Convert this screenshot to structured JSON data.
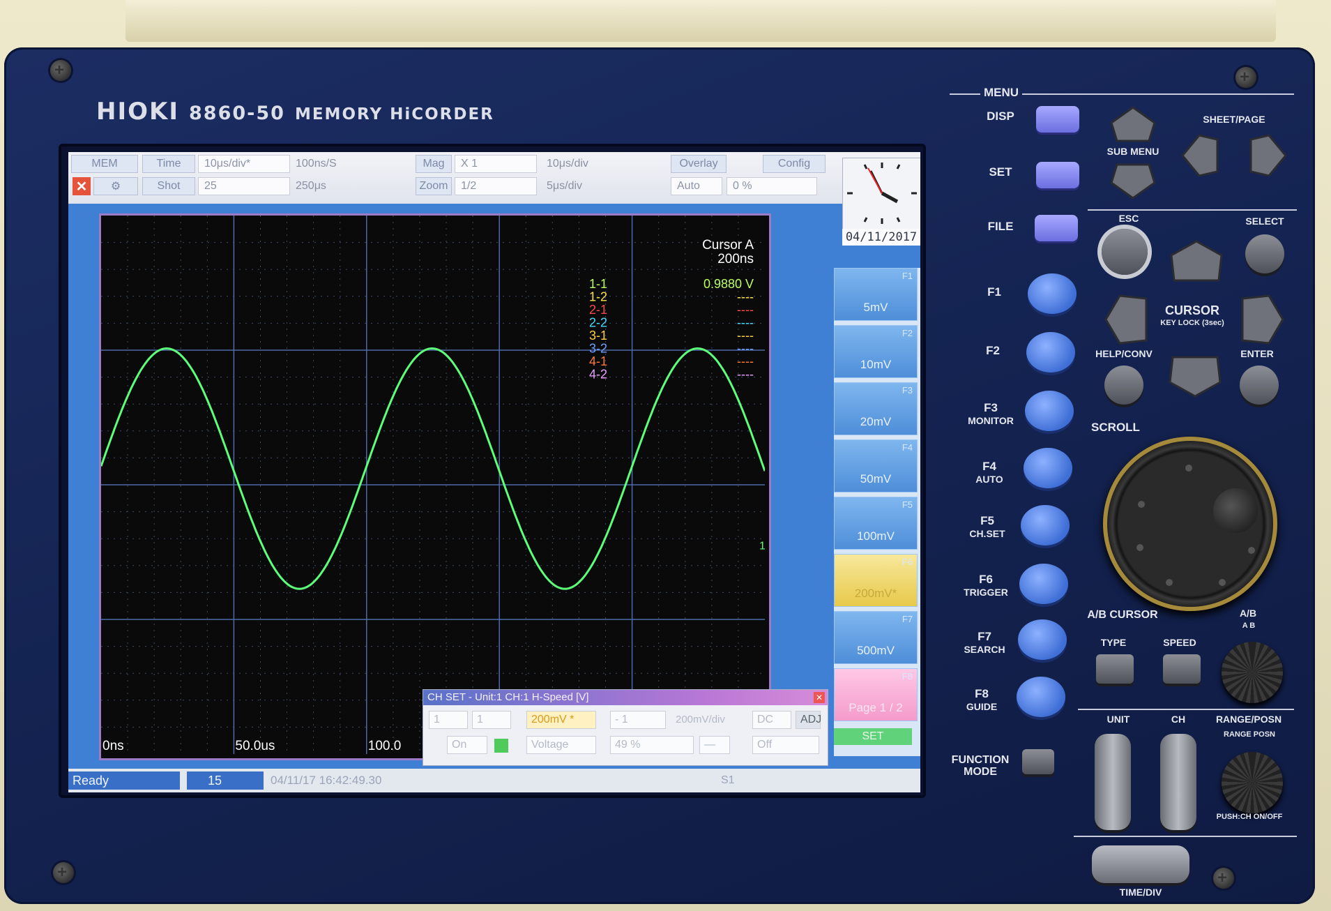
{
  "brand": {
    "logo": "HIOKI",
    "model": "8860-50",
    "name": "MEMORY HiCORDER"
  },
  "toolbar": {
    "mem": "MEM",
    "time_label": "Time",
    "time_value": "10μs/div*",
    "sample_rate": "100ns/S",
    "mag_label": "Mag",
    "mag_value": "X 1",
    "mag_div": "10μs/div",
    "overlay": "Overlay",
    "config": "Config",
    "shot_label": "Shot",
    "shot_value": "25",
    "shot_time": "250μs",
    "zoom_label": "Zoom",
    "zoom_value": "1/2",
    "zoom_div": "5μs/div",
    "trig_mode": "Auto",
    "trig_pct": "0 %"
  },
  "clock": {
    "date": "04/11/2017"
  },
  "scope": {
    "cursor_title": "Cursor A",
    "cursor_time": "200ns",
    "channels": [
      {
        "name": "1-1",
        "value": "0.9880 V",
        "color": "#b8ff5e"
      },
      {
        "name": "1-2",
        "value": "----",
        "color": "#ffe24a"
      },
      {
        "name": "2-1",
        "value": "----",
        "color": "#ff4a4a"
      },
      {
        "name": "2-2",
        "value": "----",
        "color": "#4ad8ff"
      },
      {
        "name": "3-1",
        "value": "----",
        "color": "#ffcf4a"
      },
      {
        "name": "3-2",
        "value": "----",
        "color": "#6fa0ff"
      },
      {
        "name": "4-1",
        "value": "----",
        "color": "#ff7a3a"
      },
      {
        "name": "4-2",
        "value": "----",
        "color": "#e7a0ff"
      }
    ],
    "trace_color": "#5dff7a",
    "trace_tag": "1-1",
    "x_labels": [
      "0ns",
      "50.0us",
      "100.0"
    ],
    "cycles": 2.5,
    "amplitude_fraction": 0.72
  },
  "function_keys": [
    {
      "num": "F1",
      "value": "5mV"
    },
    {
      "num": "F2",
      "value": "10mV"
    },
    {
      "num": "F3",
      "value": "20mV"
    },
    {
      "num": "F4",
      "value": "50mV"
    },
    {
      "num": "F5",
      "value": "100mV"
    },
    {
      "num": "F6",
      "value": "200mV*"
    },
    {
      "num": "F7",
      "value": "500mV"
    },
    {
      "num": "F8",
      "value": "Page 1 / 2"
    }
  ],
  "set_label": "SET",
  "dialog": {
    "title": "CH SET - Unit:1 CH:1 H-Speed [V]",
    "range": "200mV *",
    "range_div": "200mV/div",
    "coupling": "DC",
    "adj": "ADJ",
    "on": "On",
    "mode": "Voltage",
    "pos": "49 %",
    "filter": "Off",
    "one": "1",
    "neg_one": "- 1"
  },
  "status": {
    "ready": "Ready",
    "count": "15",
    "timestamp": "04/11/17 16:42:49.30",
    "sheet": "S1"
  },
  "panel": {
    "menu": "MENU",
    "disp": "DISP",
    "set": "SET",
    "file": "FILE",
    "sub_menu": "SUB MENU",
    "sheet_page": "SHEET/PAGE",
    "esc": "ESC",
    "select": "SELECT",
    "cursor": "CURSOR",
    "key_lock": "KEY LOCK (3sec)",
    "help_conv": "HELP/CONV",
    "enter": "ENTER",
    "scroll": "SCROLL",
    "f1": "F1",
    "f2": "F2",
    "f3": "F3",
    "f3_sub": "MONITOR",
    "f4": "F4",
    "f4_sub": "AUTO",
    "f5": "F5",
    "f5_sub": "CH.SET",
    "f6": "F6",
    "f6_sub": "TRIGGER",
    "f7": "F7",
    "f7_sub": "SEARCH",
    "f8": "F8",
    "f8_sub": "GUIDE",
    "function_mode": "FUNCTION MODE",
    "ab_cursor": "A/B CURSOR",
    "ab": "A/B",
    "a_b": "A  B",
    "type": "TYPE",
    "speed": "SPEED",
    "unit": "UNIT",
    "ch": "CH",
    "range_posn": "RANGE/POSN",
    "range_posn_sub": "RANGE  POSN",
    "push_ch": "PUSH:CH ON/OFF",
    "time_div": "TIME/DIV"
  }
}
